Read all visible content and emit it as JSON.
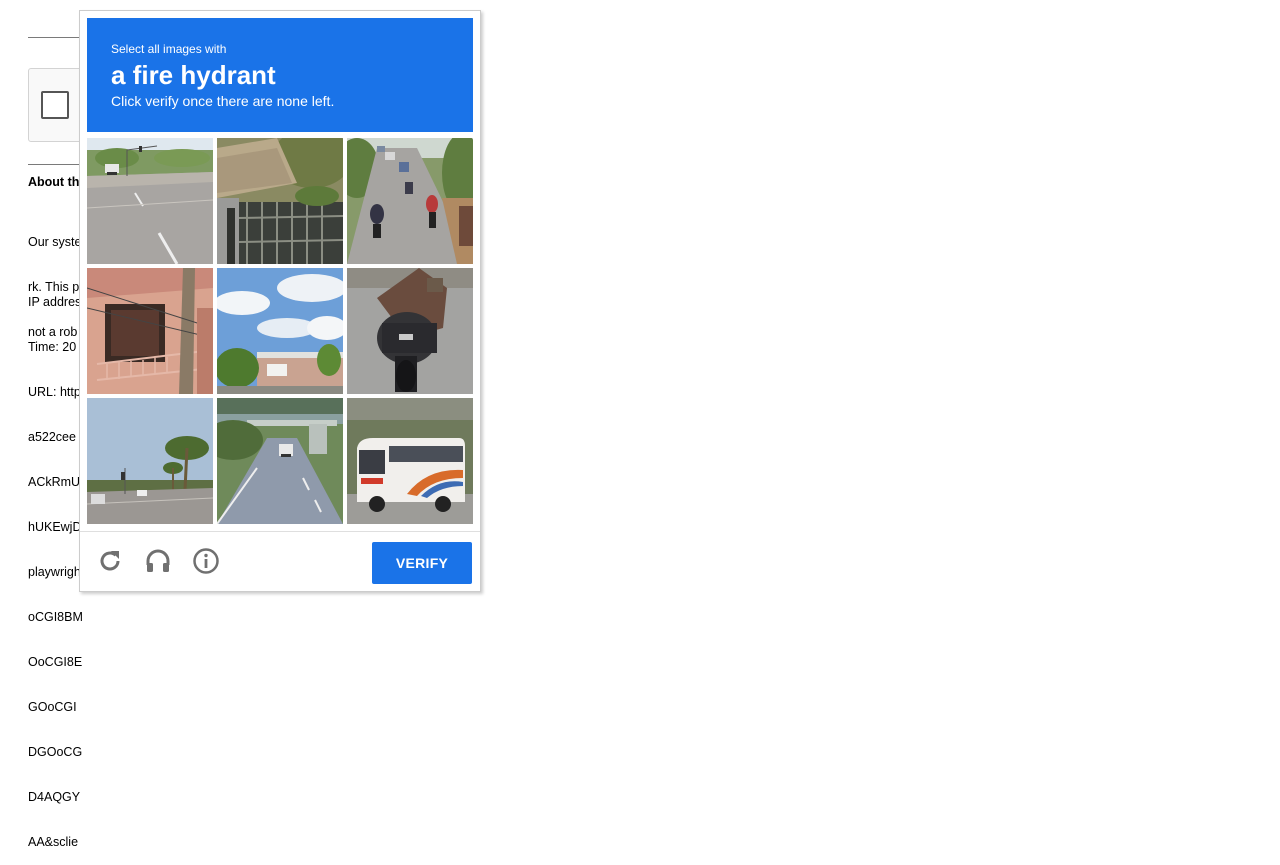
{
  "background": {
    "about_heading": "About th",
    "para1": [
      "Our syste",
      "rk. This p",
      "not a rob"
    ],
    "info": [
      "IP addres",
      "Time: 20",
      "URL: http",
      "a522cee",
      "ACkRmU",
      "hUKEwjD",
      "playwrigh",
      "oCGI8BM",
      "OoCGI8E",
      "GOoCGI",
      "DGOoCG",
      "D4AQGY",
      "AA&sclie"
    ]
  },
  "captcha": {
    "header": {
      "line1": "Select all images with",
      "target": "a fire hydrant",
      "line3": "Click verify once there are none left."
    },
    "tiles": [
      {
        "name": "road-with-car"
      },
      {
        "name": "gate-and-fence"
      },
      {
        "name": "motorcycles-on-road"
      },
      {
        "name": "building-balcony"
      },
      {
        "name": "building-and-sky"
      },
      {
        "name": "motorcycle-rider"
      },
      {
        "name": "intersection-palm-trees"
      },
      {
        "name": "highway-overpass"
      },
      {
        "name": "white-bus"
      }
    ],
    "footer": {
      "reload_icon": "reload-icon",
      "audio_icon": "headphones-icon",
      "info_icon": "info-icon",
      "verify_label": "VERIFY"
    },
    "colors": {
      "accent": "#1a73e8",
      "icon": "#707070"
    }
  }
}
